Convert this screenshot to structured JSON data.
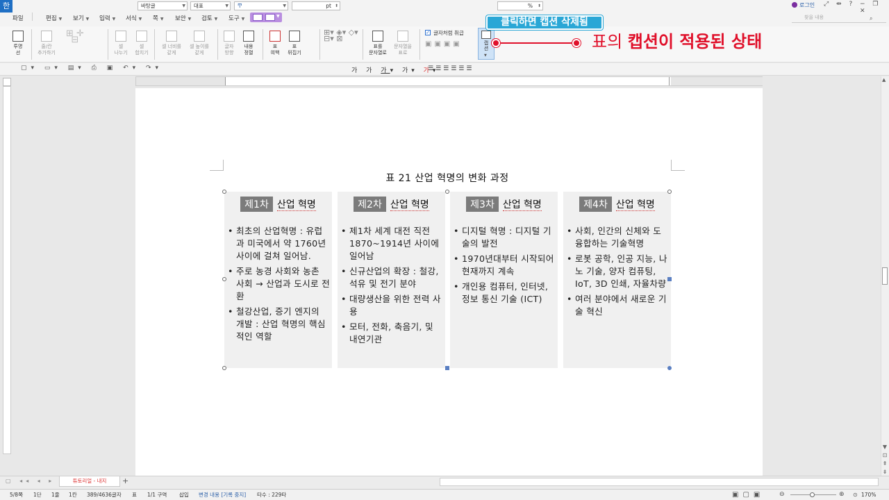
{
  "app": {
    "icon": "hwp-app-icon",
    "glyph": "한"
  },
  "topright": {
    "login": "로그인",
    "search_placeholder": "찾을 내용",
    "help": "?"
  },
  "menu": [
    "파일",
    "편집",
    "보기",
    "입력",
    "서식",
    "쪽",
    "보안",
    "검토",
    "도구"
  ],
  "ribbon": {
    "transparent": "투명\n선",
    "rowcol_add": "줄/칸\n추가하기",
    "cell_split": "셀\n나누기",
    "cell_merge": "셀\n합치기",
    "width_equal": "셀 너비를\n같게",
    "height_equal": "셀 높이를\n같게",
    "char_dir": "글자\n방향",
    "content_align": "내용\n정렬",
    "table_margin": "표\n여백",
    "table_flip": "표\n뒤집기",
    "table_as_char": "표를\n문자열로",
    "text_to_table": "문자열을\n표로",
    "treat_as_char": "글자처럼 취급",
    "caption": "캡\n션"
  },
  "toolbar": {
    "style": "바탕글",
    "lang": "대표",
    "font": "",
    "size_unit": "pt",
    "zoom": "",
    "zoom_unit": "%"
  },
  "annotations": {
    "callout1": "클릭하면 캡션 삭제됨",
    "callout2_prefix": "표의 ",
    "callout2_bold": "캡션이 적용된 상태"
  },
  "document": {
    "caption": "표 21 산업 혁명의 변화 과정",
    "columns": [
      {
        "badge": "제1차",
        "title": "산업 혁명",
        "items": [
          "최초의 산업혁명 : 유럽과 미국에서 약 1760년사이에 걸쳐 일어남.",
          "주로 농경 사회와 농촌 사회 → 산업과 도시로 전환",
          "철강산업, 증기 엔지의 개발 : 산업 혁명의 핵심적인 역할"
        ]
      },
      {
        "badge": "제2차",
        "title": "산업 혁명",
        "items": [
          "제1차 세계 대전 직전 1870~1914년 사이에 일어남",
          "신규산업의 확장 : 철강, 석유 및 전기 분야",
          "대량생산을 위한 전력 사용",
          "모터, 전화, 축음기, 및 내연기관"
        ]
      },
      {
        "badge": "제3차",
        "title": "산업 혁명",
        "items": [
          "디지털 혁명 : 디지털 기술의 발전",
          "1970년대부터 시작되어 현재까지 계속",
          "개인용 컴퓨터, 인터넷, 정보 통신 기술 (ICT)"
        ]
      },
      {
        "badge": "제4차",
        "title": "산업 혁명",
        "items": [
          "사회, 인간의 신체와 도 융합하는 기술혁명",
          "로봇 공학, 인공 지능, 나노 기술, 양자 컴퓨팅, IoT, 3D 인쇄, 자율차량",
          "여러 분야에서 새로운 기술 혁신"
        ]
      }
    ]
  },
  "tabs": {
    "doc_tab": "튜토리얼 - 내지"
  },
  "status": {
    "page": "5/8쪽",
    "section": "1단",
    "line": "1줄",
    "col": "1칸",
    "chars": "389/4636글자",
    "obj": "표",
    "area": "1/1 구역",
    "mode": "삽입",
    "track": "변경 내용 [기록 중지]",
    "typing": "타수 : 229타",
    "zoom": "170%"
  },
  "colors": {
    "accent_red": "#e0102a",
    "callout_bg": "#2aa7d6",
    "col_bg": "#f0f0f0",
    "badge_bg": "#7b7b7b"
  }
}
